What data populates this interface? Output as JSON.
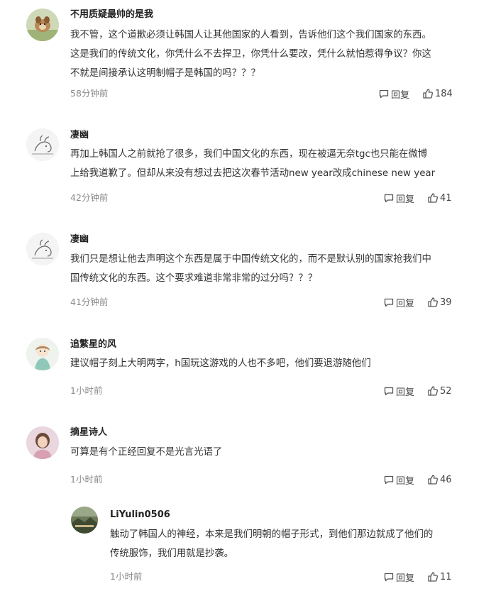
{
  "comments": [
    {
      "author": "不用质疑最帅的是我",
      "avatar": "dog-avatar",
      "lines": [
        "我不管，这个道歉必须让韩国人让其他国家的人看到，告诉他们这个我们国家的东西。",
        "这是我们的传统文化，你凭什么不去捍卫，你凭什么要改，凭什么就怕惹得争议？你这",
        "不就是间接承认这明制帽子是韩国的吗？？？"
      ],
      "time": "58分钟前",
      "reply_label": "回复",
      "likes": "184"
    },
    {
      "author": "凄幽",
      "avatar": "sketch-avatar",
      "lines": [
        "再加上韩国人之前就抢了很多，我们中国文化的东西，现在被逼无奈tgc也只能在微博",
        "上给我道歉了。但却从来没有想过去把这次春节活动new year改成chinese new year"
      ],
      "time": "42分钟前",
      "reply_label": "回复",
      "likes": "41"
    },
    {
      "author": "凄幽",
      "avatar": "sketch-avatar",
      "lines": [
        "我们只是想让他去声明这个东西是属于中国传统文化的，而不是默认别的国家抢我们中",
        "国传统文化的东西。这个要求难道非常非常的过分吗？？？"
      ],
      "time": "41分钟前",
      "reply_label": "回复",
      "likes": "39"
    },
    {
      "author": "追繁星的风",
      "avatar": "anime-girl-avatar",
      "lines": [
        "建议帽子刻上大明两字，h国玩这游戏的人也不多吧，他们要退游随他们"
      ],
      "time": "1小时前",
      "reply_label": "回复",
      "likes": "52"
    },
    {
      "author": "摘星诗人",
      "avatar": "girl-photo-avatar",
      "lines": [
        "可算是有个正经回复不是光言光语了"
      ],
      "time": "1小时前",
      "reply_label": "回复",
      "likes": "46"
    },
    {
      "author": "LiYulin0506",
      "avatar": "landscape-avatar",
      "lines": [
        "触动了韩国人的神经，本来是我们明朝的帽子形式，到他们那边就成了他们的",
        "传统服饰，我们用就是抄袭。"
      ],
      "time": "1小时前",
      "reply_label": "回复",
      "likes": "11"
    }
  ]
}
